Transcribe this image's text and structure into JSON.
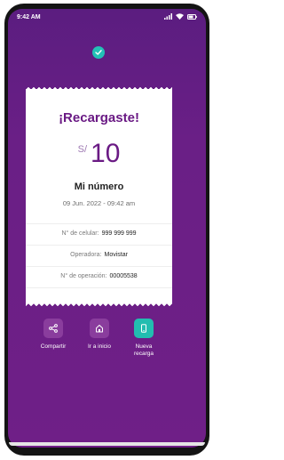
{
  "status_bar": {
    "time": "9:42 AM"
  },
  "receipt": {
    "title": "¡Recargaste!",
    "currency": "S/",
    "amount": "10",
    "subtitle": "Mi número",
    "date": "09 Jun. 2022 - 09:42 am",
    "rows": [
      {
        "label": "N° de celular:",
        "value": "999 999 999"
      },
      {
        "label": "Operadora:",
        "value": "Movistar"
      },
      {
        "label": "N° de operación:",
        "value": "00005538"
      }
    ]
  },
  "actions": [
    {
      "label": "Compartir",
      "icon": "share-icon"
    },
    {
      "label": "Ir a inicio",
      "icon": "home-icon"
    },
    {
      "label": "Nueva recarga",
      "icon": "phone-icon"
    }
  ],
  "colors": {
    "brand_purple": "#6a1a84",
    "accent_teal": "#22bdb0"
  }
}
